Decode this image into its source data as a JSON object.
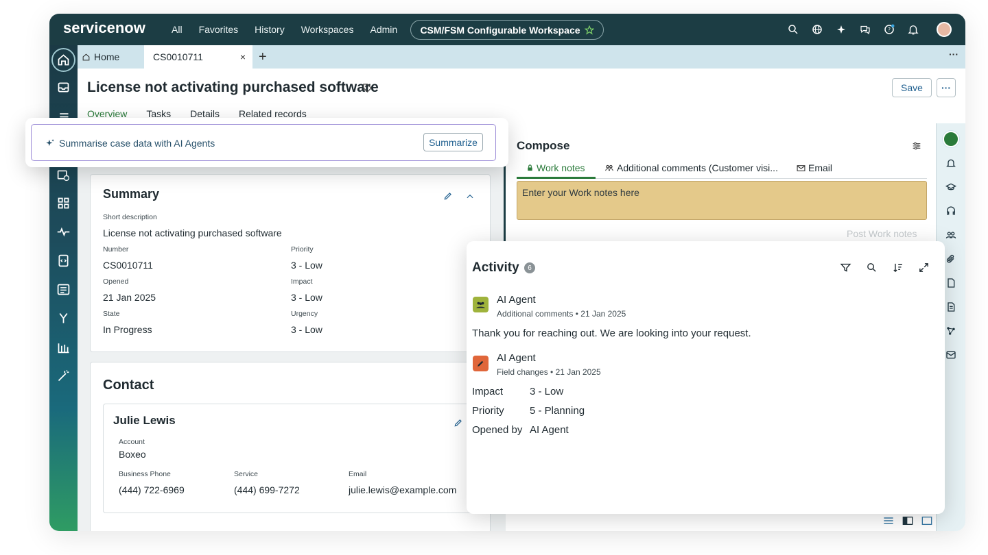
{
  "app": {
    "logo": "servicenow",
    "nav": [
      "All",
      "Favorites",
      "History",
      "Workspaces",
      "Admin"
    ],
    "workspace": "CSM/FSM Configurable Workspace",
    "top_icons": [
      "search-icon",
      "globe-icon",
      "sparkle-icon",
      "chat-icon",
      "help-icon",
      "bell-icon"
    ]
  },
  "tabs": {
    "home": "Home",
    "case": "CS0010711",
    "close": "×",
    "add": "+",
    "more": "···"
  },
  "record": {
    "title": "License not activating purchased software",
    "save": "Save",
    "more": "···",
    "subtabs": [
      "Overview",
      "Tasks",
      "Details",
      "Related records"
    ]
  },
  "ai": {
    "prompt": "Summarise case data with AI Agents",
    "button": "Summarize"
  },
  "summary": {
    "title": "Summary",
    "short_desc_label": "Short description",
    "short_desc": "License not activating purchased software",
    "number_label": "Number",
    "number": "CS0010711",
    "priority_label": "Priority",
    "priority": "3 - Low",
    "opened_label": "Opened",
    "opened": "21 Jan 2025",
    "impact_label": "Impact",
    "impact": "3 - Low",
    "state_label": "State",
    "state": "In Progress",
    "urgency_label": "Urgency",
    "urgency": "3 - Low"
  },
  "contact": {
    "title": "Contact",
    "name": "Julie Lewis",
    "account_label": "Account",
    "account": "Boxeo",
    "phone_label": "Business Phone",
    "phone": "(444) 722-6969",
    "service_label": "Service",
    "service": "(444) 699-7272",
    "email_label": "Email",
    "email": "julie.lewis@example.com"
  },
  "compose": {
    "title": "Compose",
    "tabs": [
      "Work notes",
      "Additional comments (Customer visi...",
      "Email"
    ],
    "placeholder": "Enter your Work notes here",
    "post": "Post Work notes"
  },
  "activity": {
    "title": "Activity",
    "count": "6",
    "entries": [
      {
        "author": "AI Agent",
        "type": "Additional comments",
        "date": "21 Jan 2025",
        "body": "Thank you for reaching out. We are looking into your request.",
        "icon_color": "#9fb33c"
      },
      {
        "author": "AI Agent",
        "type": "Field changes",
        "date": "21 Jan 2025",
        "icon_color": "#e0663a",
        "changes": [
          {
            "field": "Impact",
            "value": "3 - Low"
          },
          {
            "field": "Priority",
            "value": "5 - Planning"
          },
          {
            "field": "Opened by",
            "value": "AI Agent"
          }
        ]
      }
    ]
  },
  "colors": {
    "header": "#1c3d44",
    "accent_green": "#2a7a3a",
    "link_blue": "#1f5f8f",
    "notes_bg": "#e4c98a"
  }
}
